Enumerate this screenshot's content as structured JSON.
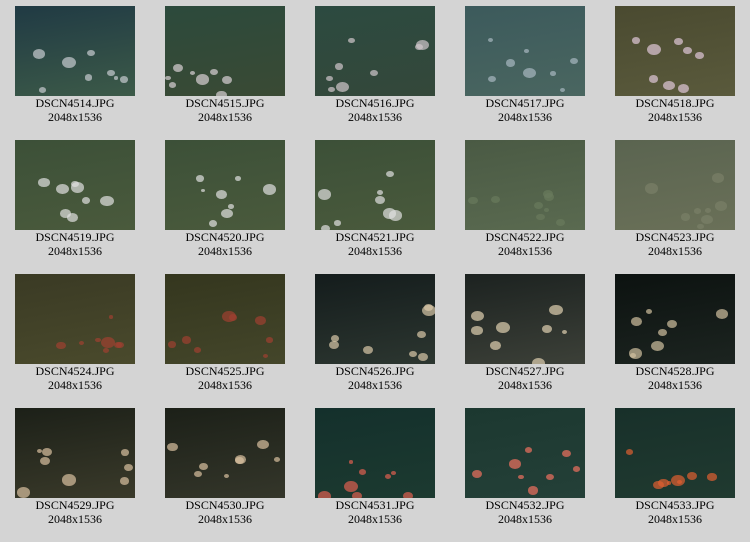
{
  "images": [
    {
      "name": "DSCN4514.JPG",
      "size": "2048x1536",
      "c1": "#203a44",
      "c2": "#3c5a48",
      "spot": "#c8ccd0"
    },
    {
      "name": "DSCN4515.JPG",
      "size": "2048x1536",
      "c1": "#2c4a3c",
      "c2": "#3a4a34",
      "spot": "#d8d0d4"
    },
    {
      "name": "DSCN4516.JPG",
      "size": "2048x1536",
      "c1": "#2c4a40",
      "c2": "#34483a",
      "spot": "#d0c8cc"
    },
    {
      "name": "DSCN4517.JPG",
      "size": "2048x1536",
      "c1": "#3c5a5c",
      "c2": "#4a6660",
      "spot": "#a8b8c0"
    },
    {
      "name": "DSCN4518.JPG",
      "size": "2048x1536",
      "c1": "#4a4a30",
      "c2": "#5a5a3c",
      "spot": "#e0c8d8"
    },
    {
      "name": "DSCN4519.JPG",
      "size": "2048x1536",
      "c1": "#3c5038",
      "c2": "#4a5a3c",
      "spot": "#e0e0e0"
    },
    {
      "name": "DSCN4520.JPG",
      "size": "2048x1536",
      "c1": "#3c5038",
      "c2": "#4a5a3c",
      "spot": "#e0e0e0"
    },
    {
      "name": "DSCN4521.JPG",
      "size": "2048x1536",
      "c1": "#3c5038",
      "c2": "#4a5a3c",
      "spot": "#e0e0e0"
    },
    {
      "name": "DSCN4522.JPG",
      "size": "2048x1536",
      "c1": "#4a5a44",
      "c2": "#5a6a50",
      "spot": "#6a7a5c"
    },
    {
      "name": "DSCN4523.JPG",
      "size": "2048x1536",
      "c1": "#5a6450",
      "c2": "#6a7058",
      "spot": "#7a8068"
    },
    {
      "name": "DSCN4524.JPG",
      "size": "2048x1536",
      "c1": "#3a3a24",
      "c2": "#4a4a2c",
      "spot": "#a04030"
    },
    {
      "name": "DSCN4525.JPG",
      "size": "2048x1536",
      "c1": "#34361e",
      "c2": "#44462a",
      "spot": "#a04030"
    },
    {
      "name": "DSCN4526.JPG",
      "size": "2048x1536",
      "c1": "#141c1c",
      "c2": "#2c3630",
      "spot": "#d8c8a8"
    },
    {
      "name": "DSCN4527.JPG",
      "size": "2048x1536",
      "c1": "#1c2220",
      "c2": "#3c4038",
      "spot": "#e0d0b0"
    },
    {
      "name": "DSCN4528.JPG",
      "size": "2048x1536",
      "c1": "#0c1210",
      "c2": "#1c2420",
      "spot": "#d0c0a0"
    },
    {
      "name": "DSCN4529.JPG",
      "size": "2048x1536",
      "c1": "#1c2018",
      "c2": "#3a3a2a",
      "spot": "#d8c0a0"
    },
    {
      "name": "DSCN4530.JPG",
      "size": "2048x1536",
      "c1": "#1c2018",
      "c2": "#34362a",
      "spot": "#d8c0a0"
    },
    {
      "name": "DSCN4531.JPG",
      "size": "2048x1536",
      "c1": "#14302c",
      "c2": "#1c3a30",
      "spot": "#e06050"
    },
    {
      "name": "DSCN4532.JPG",
      "size": "2048x1536",
      "c1": "#1c3830",
      "c2": "#244038",
      "spot": "#f07060"
    },
    {
      "name": "DSCN4533.JPG",
      "size": "2048x1536",
      "c1": "#18302a",
      "c2": "#203a30",
      "spot": "#e06030"
    }
  ]
}
